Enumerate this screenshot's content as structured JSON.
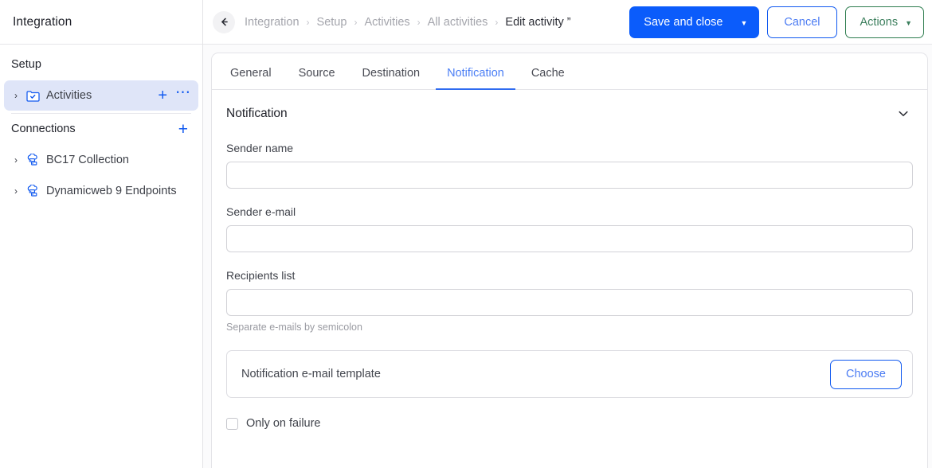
{
  "sidebar": {
    "title": "Integration",
    "sections": [
      {
        "label": "Setup",
        "add_icon": null,
        "items": [
          {
            "label": "Activities",
            "icon": "folder-check-icon",
            "selected": true,
            "twisty": "›",
            "actions": [
              "plus-icon",
              "ellipsis-icon"
            ]
          }
        ]
      },
      {
        "label": "Connections",
        "add_icon": "plus-icon",
        "items": [
          {
            "label": "BC17 Collection",
            "icon": "cloud-server-icon",
            "selected": false,
            "twisty": "›",
            "actions": []
          },
          {
            "label": "Dynamicweb 9 Endpoints",
            "icon": "cloud-server-icon",
            "selected": false,
            "twisty": "›",
            "actions": []
          }
        ]
      }
    ]
  },
  "topbar": {
    "back_icon": "arrow-left-icon",
    "breadcrumbs": [
      {
        "label": "Integration",
        "current": false
      },
      {
        "label": "Setup",
        "current": false
      },
      {
        "label": "Activities",
        "current": false
      },
      {
        "label": "All activities",
        "current": false
      },
      {
        "label": "Edit activity ”",
        "current": true
      }
    ],
    "separator": "›",
    "save_label": "Save and close",
    "save_caret": "▼",
    "cancel_label": "Cancel",
    "actions_label": "Actions",
    "actions_caret": "▼"
  },
  "tabs": [
    {
      "label": "General",
      "active": false
    },
    {
      "label": "Source",
      "active": false
    },
    {
      "label": "Destination",
      "active": false
    },
    {
      "label": "Notification",
      "active": true
    },
    {
      "label": "Cache",
      "active": false
    }
  ],
  "panel": {
    "title": "Notification",
    "collapse_icon": "chevron-down-icon",
    "fields": [
      {
        "label": "Sender name",
        "value": "",
        "placeholder": "",
        "help": ""
      },
      {
        "label": "Sender e-mail",
        "value": "",
        "placeholder": "",
        "help": ""
      },
      {
        "label": "Recipients list",
        "value": "",
        "placeholder": "",
        "help": "Separate e-mails by semicolon"
      }
    ],
    "template_picker": {
      "text": "Notification e-mail template",
      "button_label": "Choose"
    },
    "checkbox": {
      "label": "Only on failure",
      "checked": false
    }
  },
  "colors": {
    "primary_blue": "#0b5cfb",
    "link_blue": "#1059f0",
    "tab_active": "#4a7ef5",
    "green_border": "#2e7d4f",
    "selected_row_bg": "#dfe5f8",
    "muted_text": "#a4a5ac"
  }
}
